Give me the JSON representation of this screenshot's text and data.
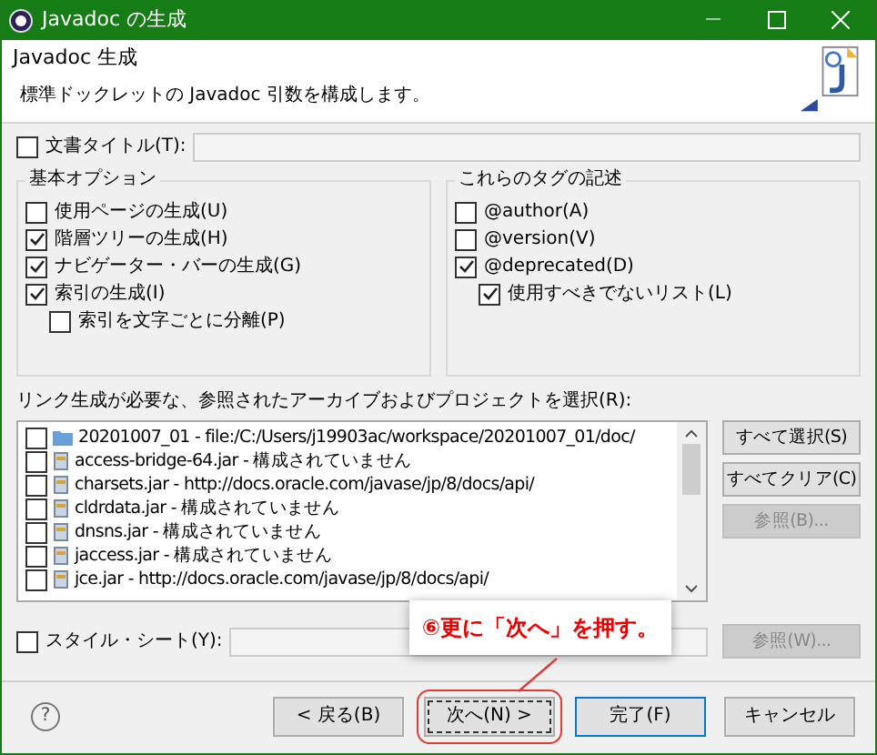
{
  "window": {
    "title": "Javadoc の生成"
  },
  "header": {
    "title": "Javadoc 生成",
    "description": "標準ドックレットの Javadoc 引数を構成します。"
  },
  "doc_title": {
    "label": "文書タイトル(T):",
    "checked": false
  },
  "basic_options": {
    "title": "基本オプション",
    "items": [
      {
        "label": "使用ページの生成(U)",
        "checked": false,
        "indented": false
      },
      {
        "label": "階層ツリーの生成(H)",
        "checked": true,
        "indented": false
      },
      {
        "label": "ナビゲーター・バーの生成(G)",
        "checked": true,
        "indented": false
      },
      {
        "label": "索引の生成(I)",
        "checked": true,
        "indented": false
      },
      {
        "label": "索引を文字ごとに分離(P)",
        "checked": false,
        "indented": true
      }
    ]
  },
  "tags": {
    "title": "これらのタグの記述",
    "items": [
      {
        "label": "@author(A)",
        "checked": false,
        "indented": false
      },
      {
        "label": "@version(V)",
        "checked": false,
        "indented": false
      },
      {
        "label": "@deprecated(D)",
        "checked": true,
        "indented": false
      },
      {
        "label": "使用すべきでないリスト(L)",
        "checked": true,
        "indented": true
      }
    ]
  },
  "links": {
    "label": "リンク生成が必要な、参照されたアーカイブおよびプロジェクトを選択(R):",
    "items": [
      {
        "label": "20201007_01 - file:/C:/Users/j19903ac/workspace/20201007_01/doc/",
        "checked": false,
        "kind": "folder"
      },
      {
        "label": "access-bridge-64.jar - 構成されていません",
        "checked": false,
        "kind": "jar"
      },
      {
        "label": "charsets.jar - http://docs.oracle.com/javase/jp/8/docs/api/",
        "checked": false,
        "kind": "jar"
      },
      {
        "label": "cldrdata.jar - 構成されていません",
        "checked": false,
        "kind": "jar"
      },
      {
        "label": "dnsns.jar - 構成されていません",
        "checked": false,
        "kind": "jar"
      },
      {
        "label": "jaccess.jar - 構成されていません",
        "checked": false,
        "kind": "jar"
      },
      {
        "label": "jce.jar - http://docs.oracle.com/javase/jp/8/docs/api/",
        "checked": false,
        "kind": "jar"
      }
    ],
    "buttons": [
      {
        "label": "すべて選択(S)",
        "disabled": false
      },
      {
        "label": "すべてクリア(C)",
        "disabled": false
      },
      {
        "label": "参照(B)...",
        "disabled": true
      }
    ]
  },
  "stylesheet": {
    "label": "スタイル・シート(Y):",
    "checked": false,
    "button": {
      "label": "参照(W)...",
      "disabled": true
    }
  },
  "callout": {
    "text": "⑥更に「次へ」を押す。"
  },
  "help": {
    "symbol": "?"
  },
  "footer_buttons": [
    {
      "label": "< 戻る(B)",
      "kind": "normal",
      "highlighted": false
    },
    {
      "label": "次へ(N) >",
      "kind": "focused",
      "highlighted": true
    },
    {
      "label": "完了(F)",
      "kind": "default",
      "highlighted": false
    },
    {
      "label": "キャンセル",
      "kind": "normal",
      "highlighted": false
    }
  ]
}
